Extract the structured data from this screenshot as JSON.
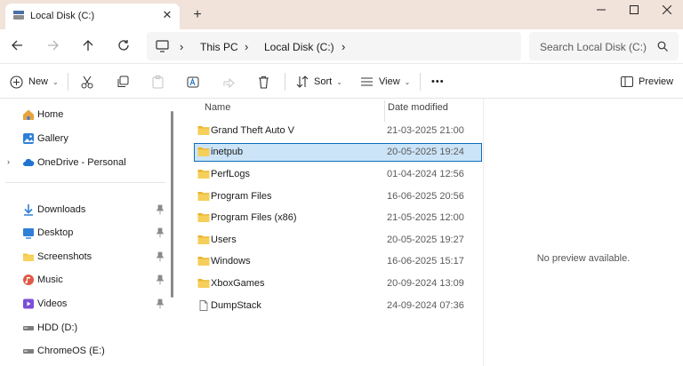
{
  "window": {
    "tab_title": "Local Disk (C:)",
    "tab_close": "✕",
    "new_tab": "+",
    "minimize": "—",
    "maximize": "☐",
    "close": "✕"
  },
  "address": {
    "separator": "›",
    "segments": [
      "This PC",
      "Local Disk (C:)"
    ]
  },
  "search": {
    "placeholder": "Search Local Disk (C:)"
  },
  "toolbar": {
    "new_label": "New",
    "sort_label": "Sort",
    "view_label": "View",
    "more_label": "•••",
    "preview_label": "Preview",
    "dropdown_glyph": "⌄"
  },
  "sidebar": {
    "expander_glyph": "›",
    "top": [
      {
        "label": "Home",
        "icon": "home-icon"
      },
      {
        "label": "Gallery",
        "icon": "gallery-icon"
      },
      {
        "label": "OneDrive - Personal",
        "icon": "cloud-icon"
      }
    ],
    "quick": [
      {
        "label": "Downloads",
        "icon": "download-icon",
        "pinned": true
      },
      {
        "label": "Desktop",
        "icon": "desktop-icon",
        "pinned": true
      },
      {
        "label": "Screenshots",
        "icon": "folder-icon",
        "pinned": true
      },
      {
        "label": "Music",
        "icon": "music-icon",
        "pinned": true
      },
      {
        "label": "Videos",
        "icon": "video-icon",
        "pinned": true
      },
      {
        "label": "HDD (D:)",
        "icon": "drive-icon",
        "pinned": false
      },
      {
        "label": "ChromeOS (E:)",
        "icon": "drive-icon",
        "pinned": false
      }
    ]
  },
  "files": {
    "columns": {
      "name": "Name",
      "date": "Date modified"
    },
    "rows": [
      {
        "name": "Grand Theft Auto V",
        "date": "21-03-2025 21:00",
        "type": "folder"
      },
      {
        "name": "inetpub",
        "date": "20-05-2025 19:24",
        "type": "folder",
        "selected": true
      },
      {
        "name": "PerfLogs",
        "date": "01-04-2024 12:56",
        "type": "folder"
      },
      {
        "name": "Program Files",
        "date": "16-06-2025 20:56",
        "type": "folder"
      },
      {
        "name": "Program Files (x86)",
        "date": "21-05-2025 12:00",
        "type": "folder"
      },
      {
        "name": "Users",
        "date": "20-05-2025 19:27",
        "type": "folder"
      },
      {
        "name": "Windows",
        "date": "16-06-2025 15:17",
        "type": "folder"
      },
      {
        "name": "XboxGames",
        "date": "20-09-2024 13:09",
        "type": "folder"
      },
      {
        "name": "DumpStack",
        "date": "24-09-2024 07:36",
        "type": "file"
      }
    ]
  },
  "preview": {
    "empty_text": "No preview available."
  },
  "colors": {
    "titlebar": "#f1e2da",
    "selection": "#cce4f7",
    "selection_border": "#0f6cbd",
    "folder": "#f4c430"
  }
}
